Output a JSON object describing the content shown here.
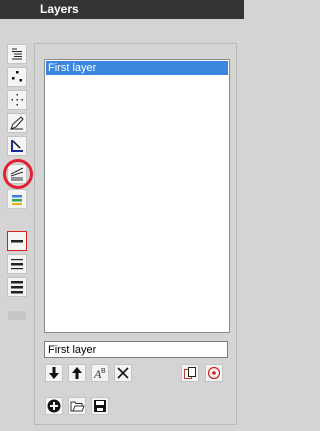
{
  "window": {
    "title": "Layers"
  },
  "toolbar": {
    "tools": [
      {
        "name": "list-icon"
      },
      {
        "name": "dots-icon"
      },
      {
        "name": "pan-icon"
      },
      {
        "name": "pencil-icon"
      },
      {
        "name": "fill-icon"
      },
      {
        "name": "lines-icon",
        "highlighted": true
      },
      {
        "name": "color-bars-icon"
      }
    ],
    "line_weights": [
      {
        "name": "thin-line-icon",
        "selected": true
      },
      {
        "name": "medium-line-icon",
        "selected": false
      },
      {
        "name": "thick-line-icon",
        "selected": false
      }
    ]
  },
  "layers": {
    "items": [
      {
        "label": "First layer",
        "selected": true
      }
    ],
    "name_field": {
      "value": "First layer"
    }
  },
  "actions": {
    "row1": [
      "move-down-icon",
      "move-up-icon",
      "rename-icon",
      "delete-icon",
      "copy-icon",
      "target-icon"
    ],
    "row2": [
      "add-icon",
      "open-icon",
      "save-icon"
    ]
  },
  "colors": {
    "accent": "#3b86df",
    "highlight_ring": "#e12030",
    "titlebar": "#343434"
  }
}
